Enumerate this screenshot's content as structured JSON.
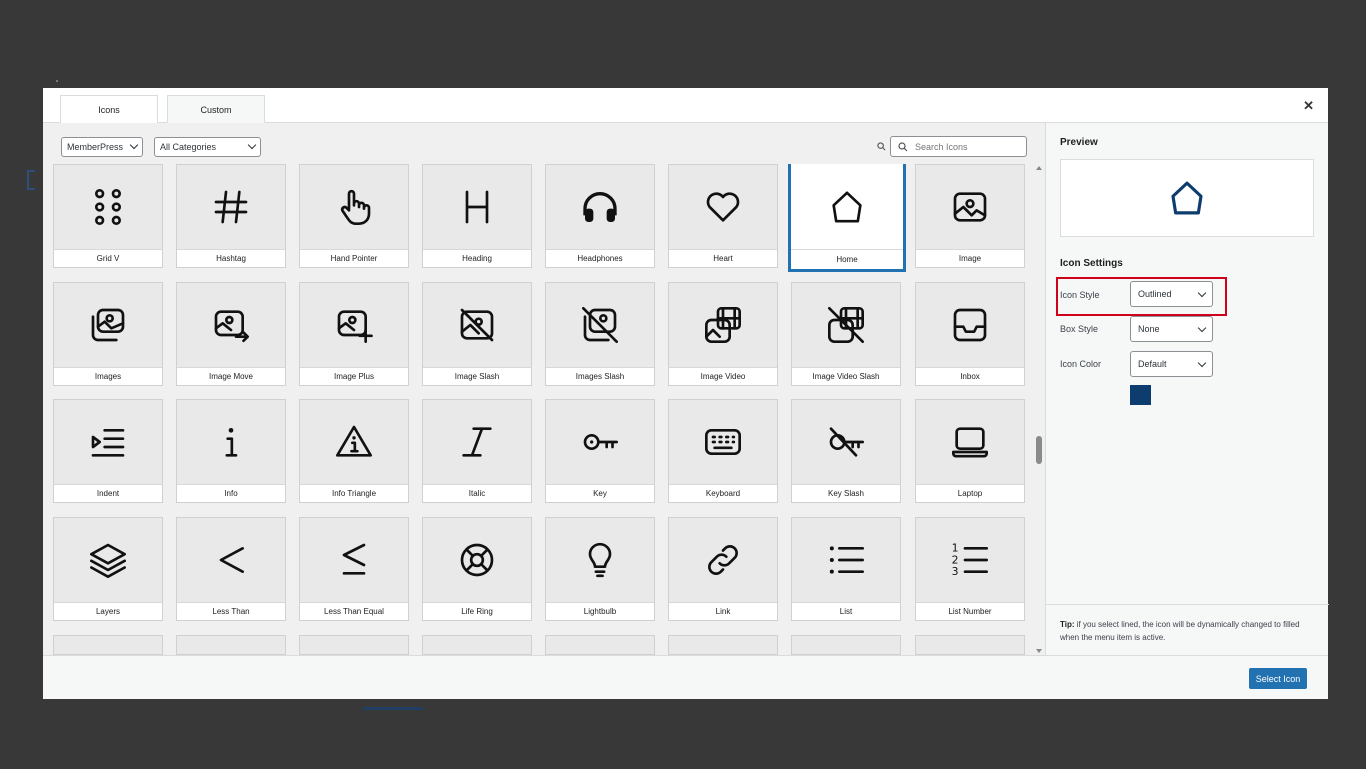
{
  "tabs": [
    {
      "label": "Icons",
      "active": true
    },
    {
      "label": "Custom",
      "active": false
    }
  ],
  "close_icon": "close-icon",
  "filters": {
    "plugin_select": "MemberPress",
    "category_select": "All Categories",
    "search_placeholder": "Search Icons"
  },
  "icons": [
    {
      "label": "Grid V",
      "icon": "grid-v-icon"
    },
    {
      "label": "Hashtag",
      "icon": "hashtag-icon"
    },
    {
      "label": "Hand Pointer",
      "icon": "hand-pointer-icon"
    },
    {
      "label": "Heading",
      "icon": "heading-icon"
    },
    {
      "label": "Headphones",
      "icon": "headphones-icon"
    },
    {
      "label": "Heart",
      "icon": "heart-icon"
    },
    {
      "label": "Home",
      "icon": "home-icon",
      "selected": true
    },
    {
      "label": "Image",
      "icon": "image-icon"
    },
    {
      "label": "Images",
      "icon": "images-icon"
    },
    {
      "label": "Image Move",
      "icon": "image-move-icon"
    },
    {
      "label": "Image Plus",
      "icon": "image-plus-icon"
    },
    {
      "label": "Image Slash",
      "icon": "image-slash-icon"
    },
    {
      "label": "Images Slash",
      "icon": "images-slash-icon"
    },
    {
      "label": "Image Video",
      "icon": "image-video-icon"
    },
    {
      "label": "Image Video Slash",
      "icon": "image-video-slash-icon"
    },
    {
      "label": "Inbox",
      "icon": "inbox-icon"
    },
    {
      "label": "Indent",
      "icon": "indent-icon"
    },
    {
      "label": "Info",
      "icon": "info-icon"
    },
    {
      "label": "Info Triangle",
      "icon": "info-triangle-icon"
    },
    {
      "label": "Italic",
      "icon": "italic-icon"
    },
    {
      "label": "Key",
      "icon": "key-icon"
    },
    {
      "label": "Keyboard",
      "icon": "keyboard-icon"
    },
    {
      "label": "Key Slash",
      "icon": "key-slash-icon"
    },
    {
      "label": "Laptop",
      "icon": "laptop-icon"
    },
    {
      "label": "Layers",
      "icon": "layers-icon"
    },
    {
      "label": "Less Than",
      "icon": "less-than-icon"
    },
    {
      "label": "Less Than Equal",
      "icon": "less-than-equal-icon"
    },
    {
      "label": "Life Ring",
      "icon": "life-ring-icon"
    },
    {
      "label": "Lightbulb",
      "icon": "lightbulb-icon"
    },
    {
      "label": "Link",
      "icon": "link-icon"
    },
    {
      "label": "List",
      "icon": "list-icon"
    },
    {
      "label": "List Number",
      "icon": "list-number-icon"
    }
  ],
  "sidebar": {
    "preview_title": "Preview",
    "preview_icon": "home-icon",
    "settings_title": "Icon Settings",
    "icon_style_label": "Icon Style",
    "icon_style_value": "Outlined",
    "box_style_label": "Box Style",
    "box_style_value": "None",
    "icon_color_label": "Icon Color",
    "icon_color_value": "Default",
    "swatch_color": "#0d3d6e",
    "tip_bold": "Tip:",
    "tip_text": " if you select lined, the icon will be dynamically changed to filled when the menu item is active."
  },
  "footer": {
    "select_button": "Select Icon"
  },
  "colors": {
    "accent": "#2271b1",
    "highlight": "#d0021b",
    "preview_icon": "#0d3d6e"
  }
}
